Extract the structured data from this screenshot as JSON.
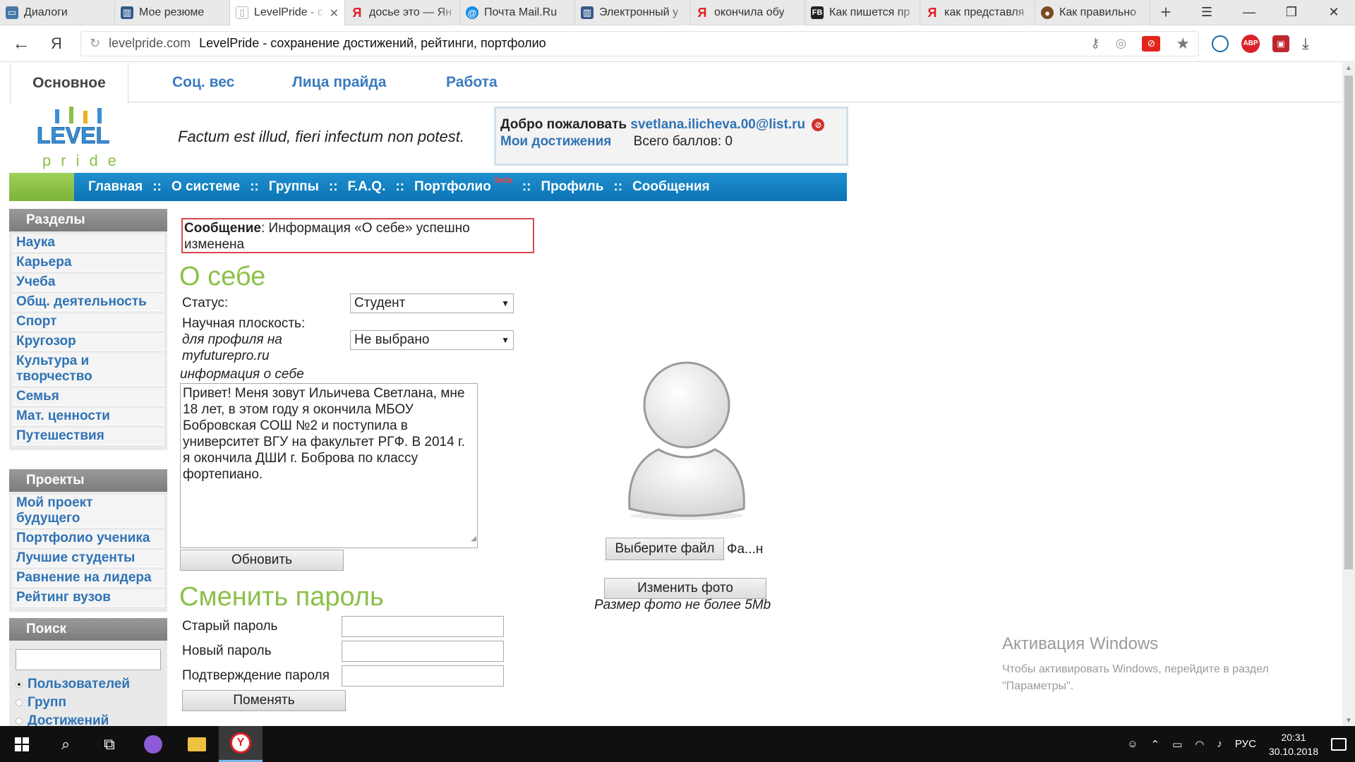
{
  "browser": {
    "tabs": [
      {
        "label": "Диалоги",
        "icon": "vk-dialog-icon",
        "color": "#4a76a8"
      },
      {
        "label": "Мое резюме",
        "icon": "chart-favicon-icon",
        "color": "#335a8a"
      },
      {
        "label": "LevelPride - с",
        "icon": "page-favicon-icon",
        "color": "#cccccc",
        "active": true
      },
      {
        "label": "досье это — Ян",
        "icon": "yandex-icon",
        "color": "#e31e24"
      },
      {
        "label": "Почта Mail.Ru",
        "icon": "mail-at-icon",
        "color": "#168de2"
      },
      {
        "label": "Электронный у",
        "icon": "chart-favicon-icon",
        "color": "#335a8a"
      },
      {
        "label": "окончила обу",
        "icon": "yandex-icon",
        "color": "#e31e24"
      },
      {
        "label": "Как пишется пр",
        "icon": "fb-icon",
        "color": "#222222"
      },
      {
        "label": "как представля",
        "icon": "yandex-icon",
        "color": "#e31e24"
      },
      {
        "label": "Как правильно",
        "icon": "owl-icon",
        "color": "#7a4a20"
      }
    ],
    "address": {
      "ya": "Я",
      "domain": "levelpride.com",
      "page_title": "LevelPride - сохранение достижений, рейтинги, портфолио"
    },
    "ext": {
      "abp": "ABP"
    }
  },
  "site": {
    "top_tabs": [
      "Основное",
      "Соц. вес",
      "Лица прайда",
      "Работа"
    ],
    "logo": {
      "word1": "LEVEL",
      "word2": "pride"
    },
    "motto": "Factum est illud, fieri infectum non potest.",
    "welcome": {
      "greeting": "Добро пожаловать",
      "user": "svetlana.ilicheva.00@list.ru",
      "achievements": "Мои достижения",
      "score": "Всего баллов: 0"
    },
    "menu": {
      "home": "Главная",
      "about": "О системе",
      "groups": "Группы",
      "faq": "F.A.Q.",
      "portfolio": "Портфолио",
      "beta": "beta",
      "profile": "Профиль",
      "messages": "Сообщения",
      "sep": "::"
    },
    "sidebar": {
      "sections_title": "Разделы",
      "sections": [
        "Наука",
        "Карьера",
        "Учеба",
        "Общ. деятельность",
        "Спорт",
        "Кругозор",
        "Культура и творчество",
        "Семья",
        "Мат. ценности",
        "Путешествия"
      ],
      "projects_title": "Проекты",
      "projects": [
        "Мой проект будущего",
        "Портфолио ученика",
        "Лучшие студенты",
        "Равнение на лидера",
        "Рейтинг вузов"
      ],
      "search_title": "Поиск",
      "search_options": [
        "Пользователей",
        "Групп",
        "Достижений"
      ]
    },
    "message": {
      "label": "Сообщение",
      "text": ": Информация «О себе» успешно изменена"
    },
    "about": {
      "title": "О себе",
      "status_label": "Статус:",
      "status_value": "Студент",
      "field_label": "Научная плоскость:",
      "field_value": "Не выбрано",
      "for_profile": "для профиля на",
      "profile_site": "myfuturepro.ru",
      "info_label": "информация о себе",
      "info_text": "Привет! Меня зовут Ильичева Светлана, мне 18 лет, в этом году я окончила МБОУ Бобровская СОШ №2 и поступила в университет ВГУ на факультет РГФ. В 2014 г. я окончила ДШИ г. Боброва по классу фортепиано.",
      "update_button": "Обновить"
    },
    "photo": {
      "choose_file": "Выберите файл",
      "file_name": "Фа...н",
      "change_button": "Изменить фото",
      "hint": "Размер фото не более 5Mb"
    },
    "password": {
      "title": "Сменить пароль",
      "old_label": "Старый пароль",
      "new_label": "Новый пароль",
      "confirm_label": "Подтверждение пароля",
      "change_button": "Поменять"
    }
  },
  "activation": {
    "title": "Активация Windows",
    "text": "Чтобы активировать Windows, перейдите в раздел \"Параметры\"."
  },
  "taskbar": {
    "lang": "РУС",
    "time": "20:31",
    "date": "30.10.2018"
  }
}
